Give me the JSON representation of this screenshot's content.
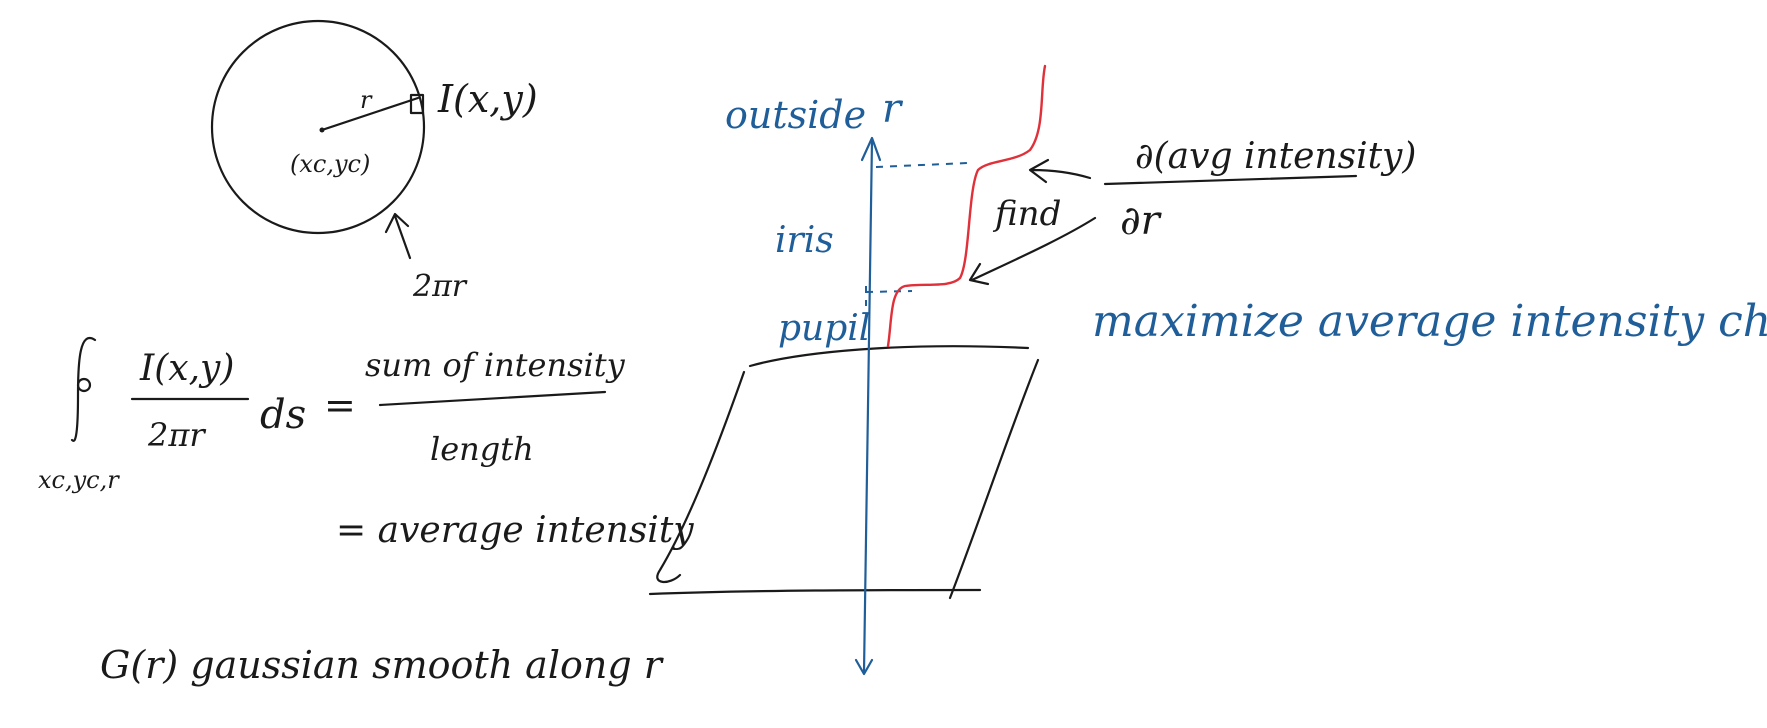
{
  "circle": {
    "r_label": "r",
    "point_label": "I(x,y)",
    "center_label": "(xc,yc)",
    "circumference_label": "2πr"
  },
  "integral": {
    "subscript": "xc,yc,r",
    "numerator": "I(x,y)",
    "denominator": "2πr",
    "ds": "ds",
    "equals": "=",
    "frac_numerator": "sum of intensity",
    "frac_denominator": "length",
    "result": "= average intensity"
  },
  "smoothing": {
    "text": "G(r)   gaussian smooth along r"
  },
  "graph": {
    "axis_label": "r",
    "outside_label": "outside",
    "iris_label": "iris",
    "pupil_label": "pupil"
  },
  "derivative": {
    "numerator": "∂(avg intensity)",
    "denominator": "∂r",
    "find_label": "find"
  },
  "goal": {
    "text": "maximize average intensity change"
  },
  "colors": {
    "ink": "#1a1a1a",
    "blue": "#1f5e99",
    "red": "#e0303a"
  }
}
